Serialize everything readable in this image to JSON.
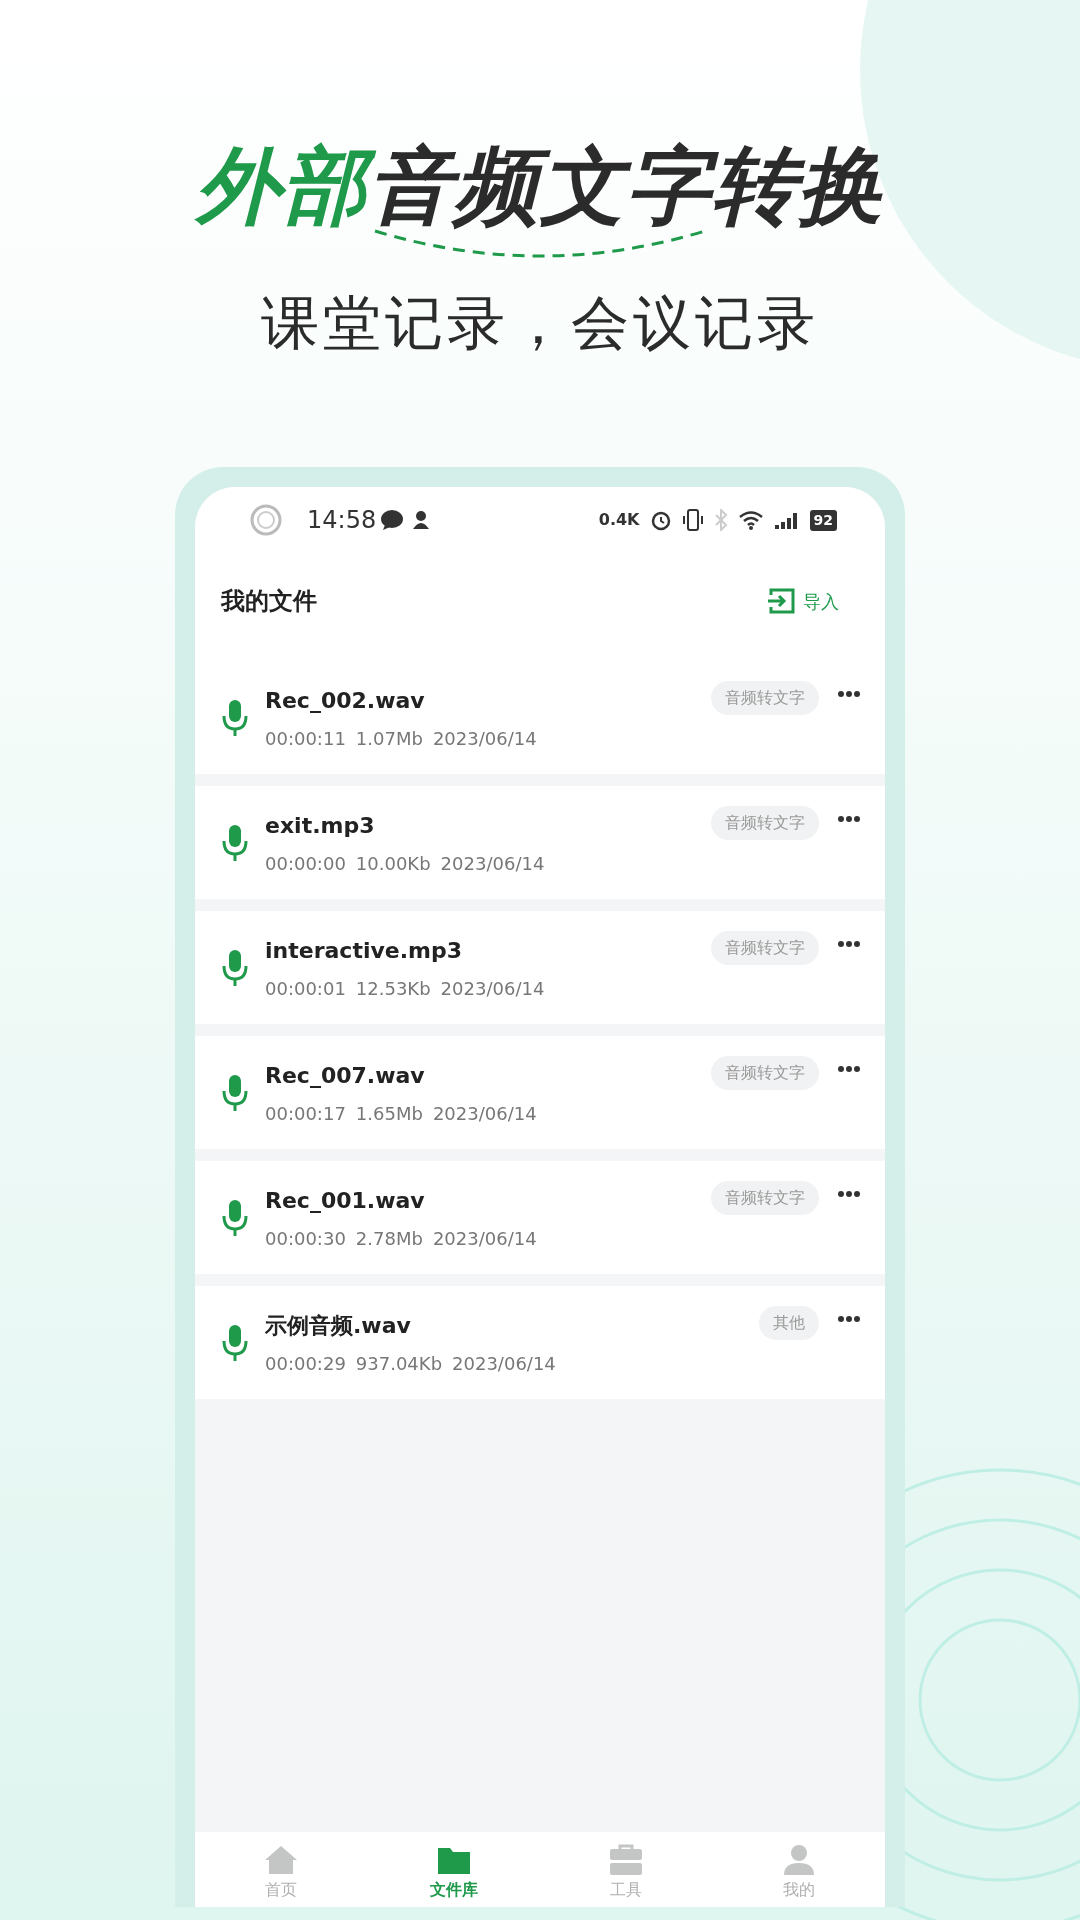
{
  "headline": {
    "highlight": "外部",
    "rest": "音频文字转换"
  },
  "subtitle": "课堂记录，会议记录",
  "status_bar": {
    "time": "14:58",
    "net_speed": "0.4K",
    "battery": "92"
  },
  "header": {
    "title": "我的文件",
    "import_label": "导入"
  },
  "files": [
    {
      "name": "Rec_002.wav",
      "duration": "00:00:11",
      "size": "1.07Mb",
      "date": "2023/06/14",
      "tag": "音频转文字"
    },
    {
      "name": "exit.mp3",
      "duration": "00:00:00",
      "size": "10.00Kb",
      "date": "2023/06/14",
      "tag": "音频转文字"
    },
    {
      "name": "interactive.mp3",
      "duration": "00:00:01",
      "size": "12.53Kb",
      "date": "2023/06/14",
      "tag": "音频转文字"
    },
    {
      "name": "Rec_007.wav",
      "duration": "00:00:17",
      "size": "1.65Mb",
      "date": "2023/06/14",
      "tag": "音频转文字"
    },
    {
      "name": "Rec_001.wav",
      "duration": "00:00:30",
      "size": "2.78Mb",
      "date": "2023/06/14",
      "tag": "音频转文字"
    },
    {
      "name": "示例音频.wav",
      "duration": "00:00:29",
      "size": "937.04Kb",
      "date": "2023/06/14",
      "tag": "其他"
    }
  ],
  "tab_bar": [
    {
      "label": "首页",
      "selected": false
    },
    {
      "label": "文件库",
      "selected": true
    },
    {
      "label": "工具",
      "selected": false
    },
    {
      "label": "我的",
      "selected": false
    }
  ]
}
